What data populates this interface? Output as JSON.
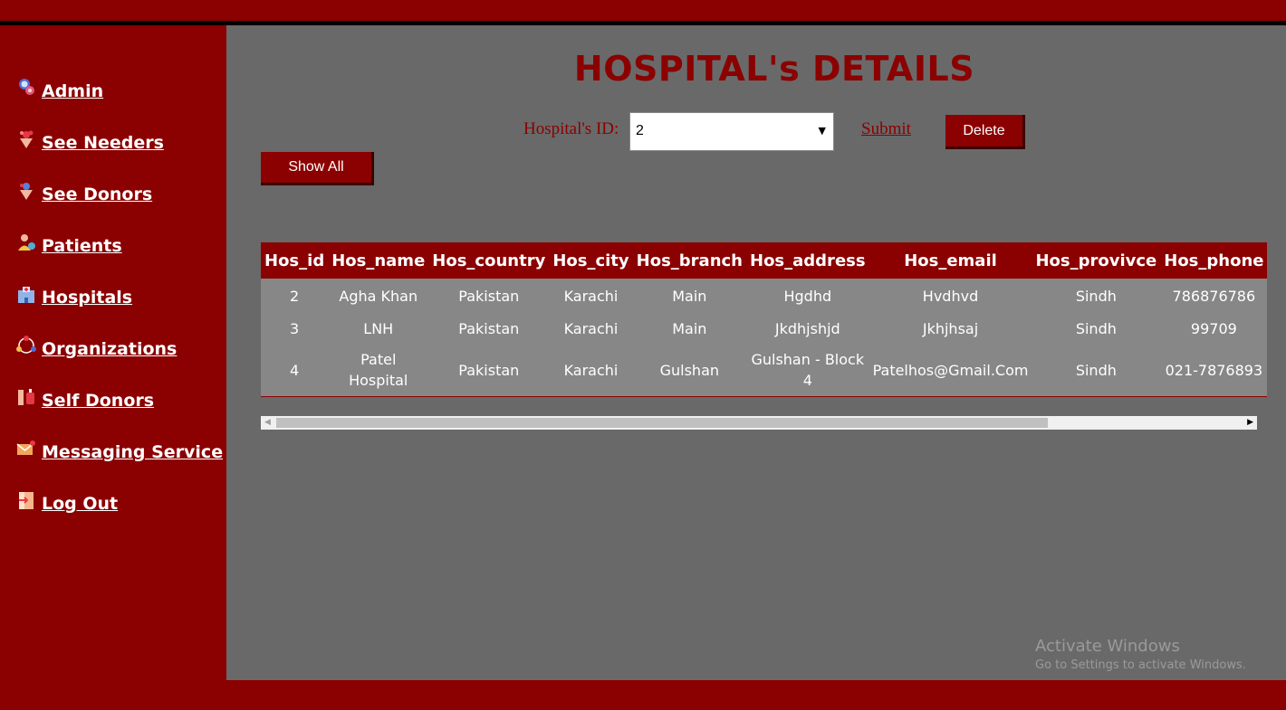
{
  "sidebar": {
    "items": [
      {
        "label": " Admin",
        "icon": "admin-icon"
      },
      {
        "label": " See Needers",
        "icon": "needers-icon"
      },
      {
        "label": " See Donors",
        "icon": "donors-icon"
      },
      {
        "label": " Patients",
        "icon": "patients-icon"
      },
      {
        "label": " Hospitals",
        "icon": "hospital-icon"
      },
      {
        "label": " Organizations",
        "icon": "organizations-icon"
      },
      {
        "label": " Self Donors",
        "icon": "blood-bag-icon"
      },
      {
        "label": " Messaging Service",
        "icon": "envelope-icon"
      },
      {
        "label": " Log Out",
        "icon": "logout-icon"
      }
    ]
  },
  "main": {
    "title": "HOSPITAL's DETAILS",
    "id_label": "Hospital's ID:",
    "id_selected": "2",
    "submit_label": "Submit",
    "delete_label": "Delete",
    "show_all_label": "Show All"
  },
  "table": {
    "headers": [
      "Hos_id",
      "Hos_name",
      "Hos_country",
      "Hos_city",
      "Hos_branch",
      "Hos_address",
      "Hos_email",
      "Hos_provivce",
      "Hos_phone"
    ],
    "rows": [
      [
        "2",
        "Agha Khan",
        "Pakistan",
        "Karachi",
        "Main",
        "Hgdhd",
        "Hvdhvd",
        "Sindh",
        "786876786"
      ],
      [
        "3",
        "LNH",
        "Pakistan",
        "Karachi",
        "Main",
        "Jkdhjshjd",
        "Jkhjhsaj",
        "Sindh",
        "99709"
      ],
      [
        "4",
        "Patel Hospital",
        "Pakistan",
        "Karachi",
        "Gulshan",
        "Gulshan - Block 4",
        "Patelhos@Gmail.Com",
        "Sindh",
        "021-7876893"
      ]
    ]
  },
  "watermark": {
    "title": "Activate Windows",
    "subtitle": "Go to Settings to activate Windows."
  },
  "colors": {
    "brand": "#8b0000",
    "content_bg": "#696969",
    "row_bg": "#878787"
  }
}
